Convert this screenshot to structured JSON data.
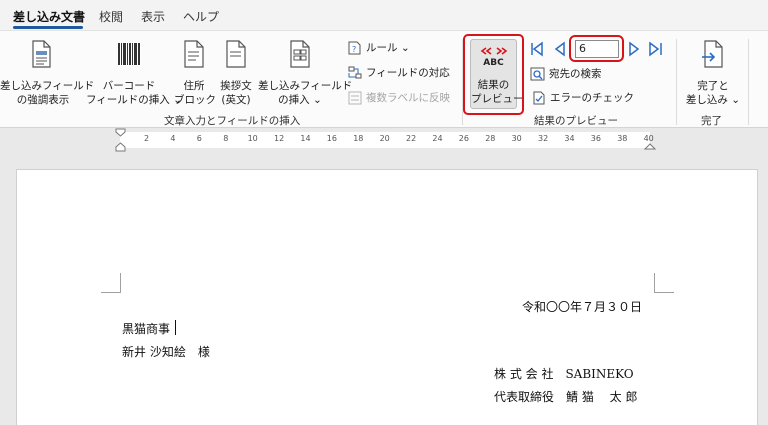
{
  "tabs": [
    {
      "label": "差し込み文書",
      "active": true
    },
    {
      "label": "校閲"
    },
    {
      "label": "表示"
    },
    {
      "label": "ヘルプ"
    }
  ],
  "ribbon": {
    "highlight_button": {
      "line1": "差し込みフィールド",
      "line2": "の強調表示"
    },
    "barcode_button": {
      "line1": "バーコード",
      "line2": "フィールドの挿入 ⌄"
    },
    "address_block_button": {
      "line1": "住所",
      "line2": "ブロック"
    },
    "greeting_button": {
      "line1": "挨拶文",
      "line2": "(英文)"
    },
    "insert_field_button": {
      "line1": "差し込みフィールド",
      "line2": "の挿入 ⌄"
    },
    "rules_button": "ルール ⌄",
    "match_fields_button": "フィールドの対応",
    "update_labels_button": "複数ラベルに反映",
    "group_write_insert": "文章入力とフィールドの挿入",
    "preview_button": {
      "icon_text": "ABC",
      "line1": "結果の",
      "line2": "プレビュー"
    },
    "record_number": "6",
    "find_recipient_button": "宛先の検索",
    "check_errors_button": "エラーのチェック",
    "group_preview": "結果のプレビュー",
    "finish_button": {
      "line1": "完了と",
      "line2": "差し込み ⌄"
    },
    "group_finish": "完了"
  },
  "ruler": {
    "numbers": [
      "2",
      "4",
      "6",
      "8",
      "10",
      "12",
      "14",
      "16",
      "18",
      "20",
      "22",
      "24",
      "26",
      "28",
      "30",
      "32",
      "34",
      "36",
      "38",
      "40"
    ]
  },
  "document": {
    "date": "令和〇〇年７月３０日",
    "recipient_company": "黒猫商事",
    "recipient_name": "新井 沙知絵　様",
    "sender_company": "株 式 会 社　SABINEKO",
    "sender_name": "代表取締役　鯖 猫　 太 郎"
  },
  "colors": {
    "accent": "#1e5a9c",
    "highlight_outline": "#d6141a",
    "nav_arrow": "#2b6cc4"
  }
}
